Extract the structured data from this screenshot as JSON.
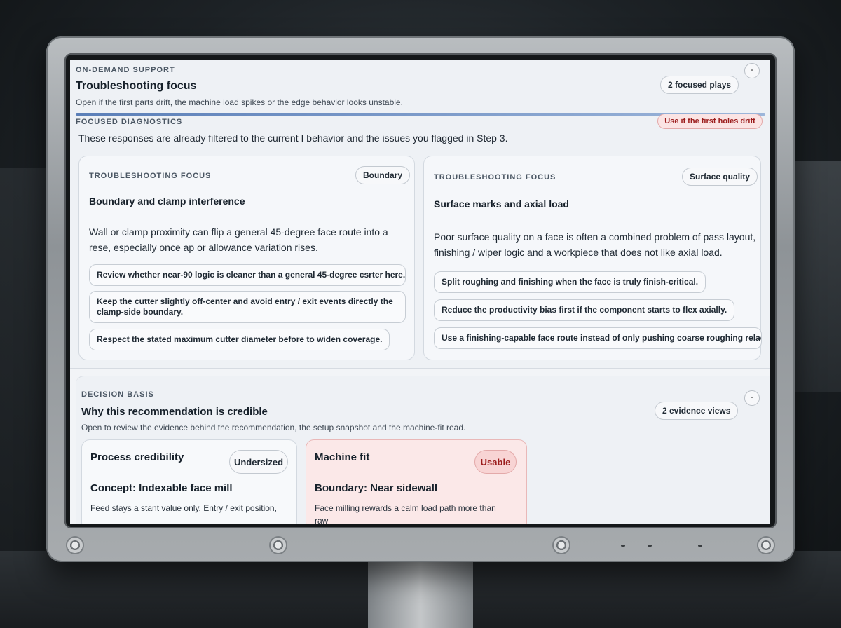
{
  "troubleshooting": {
    "eyebrow": "ON-DEMAND SUPPORT",
    "title": "Troubleshooting focus",
    "subtitle": "Open if the first parts drift, the machine load spikes or the edge behavior looks unstable.",
    "count_badge": "2 focused plays",
    "collapse_glyph": "-",
    "diagnostics_eyebrow": "FOCUSED DIAGNOSTICS",
    "warning_badge": "Use if the first holes drift",
    "description": "These responses are already filtered to the current I behavior and the issues you flagged in Step 3.",
    "cards": [
      {
        "eyebrow": "TROUBLESHOOTING FOCUS",
        "tag": "Boundary",
        "title": "Boundary and clamp interference",
        "body": "Wall or clamp proximity can flip a general 45-degree face route into a rese, especially once ap or allowance variation rises.",
        "actions": [
          "Review whether near-90 logic is cleaner than a general 45-degree csrter here.",
          "Keep the cutter slightly off-center and avoid entry / exit events directly  the clamp-side boundary.",
          "Respect the stated maximum cutter diameter before to  widen coverage."
        ]
      },
      {
        "eyebrow": "TROUBLESHOOTING FOCUS",
        "tag": "Surface quality",
        "title": "Surface marks and axial load",
        "body": "Poor surface quality on a face is often a combined problem of pass layout, finishing / wiper logic and a workpiece that does not like axial load.",
        "actions": [
          "Split roughing and finishing when the face is truly finish-critical.",
          "Reduce the productivity bias first if the component starts to flex axially.",
          "Use a finishing-capable face route instead of only pushing coarse roughing relaes"
        ]
      }
    ]
  },
  "decision": {
    "eyebrow": "DECISION BASIS",
    "title": "Why this recommendation is credible",
    "subtitle": "Open to review the evidence behind the recommendation, the setup snapshot and the machine-fit read.",
    "count_badge": "2 evidence views",
    "collapse_glyph": "-",
    "cards": [
      {
        "title": "Process credibility",
        "badge": "Undersized",
        "heading": "Concept: Indexable face mill",
        "text": "Feed stays a stant value only. Entry / exit position,"
      },
      {
        "title": "Machine fit",
        "badge": "Usable",
        "heading": "Boundary: Near sidewall",
        "text": "Face milling rewards a calm load path more than raw"
      }
    ]
  },
  "colors": {
    "accent_rule": "#5b7fb8",
    "warning": "#9b1c1c",
    "warning_bg": "#fbe4e4"
  }
}
